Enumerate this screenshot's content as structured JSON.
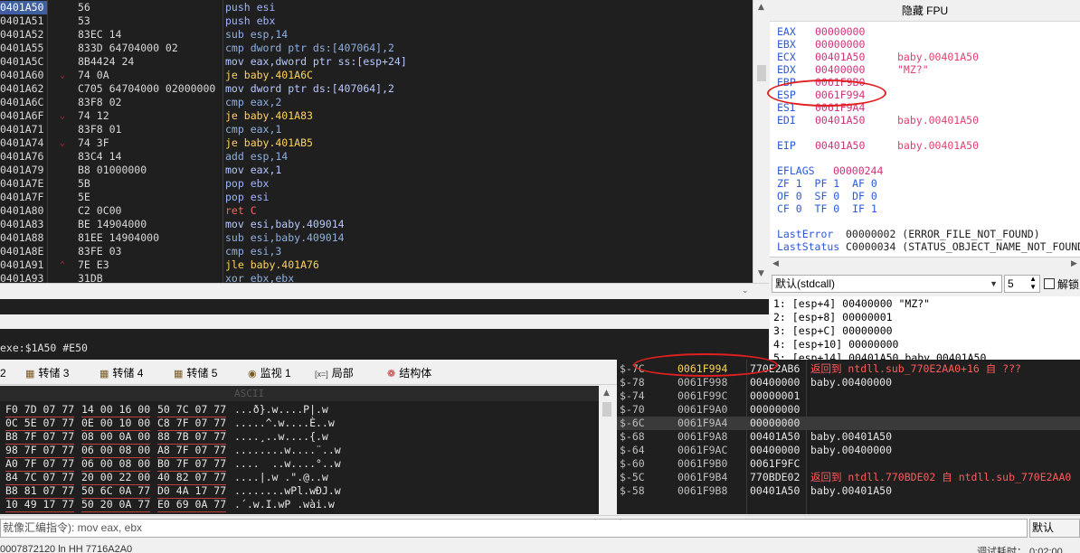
{
  "disassembly": [
    {
      "addr": "0401A50",
      "jmp": "",
      "bytes": "56",
      "ins": "push esi",
      "cls": "c-push",
      "sel": true
    },
    {
      "addr": "0401A51",
      "jmp": "",
      "bytes": "53",
      "ins": "push ebx",
      "cls": "c-push"
    },
    {
      "addr": "0401A52",
      "jmp": "",
      "bytes": "83EC 14",
      "ins": "sub esp,14",
      "cls": "c-arith"
    },
    {
      "addr": "0401A55",
      "jmp": "",
      "bytes": "833D 64704000 02",
      "ins": "cmp dword ptr ds:[407064],2",
      "cls": "c-arith"
    },
    {
      "addr": "0401A5C",
      "jmp": "",
      "bytes": "8B4424 24",
      "ins": "mov eax,dword ptr ss:[esp+24]",
      "cls": "c-mov"
    },
    {
      "addr": "0401A60",
      "jmp": "⌄",
      "bytes": "74 0A",
      "ins": "je baby.401A6C",
      "cls": "c-jmp"
    },
    {
      "addr": "0401A62",
      "jmp": "",
      "bytes": "C705 64704000 02000000",
      "ins": "mov dword ptr ds:[407064],2",
      "cls": "c-mov"
    },
    {
      "addr": "0401A6C",
      "jmp": "",
      "bytes": "83F8 02",
      "ins": "cmp eax,2",
      "cls": "c-arith"
    },
    {
      "addr": "0401A6F",
      "jmp": "⌄",
      "bytes": "74 12",
      "ins": "je baby.401A83",
      "cls": "c-jmp"
    },
    {
      "addr": "0401A71",
      "jmp": "",
      "bytes": "83F8 01",
      "ins": "cmp eax,1",
      "cls": "c-arith"
    },
    {
      "addr": "0401A74",
      "jmp": "⌄",
      "bytes": "74 3F",
      "ins": "je baby.401AB5",
      "cls": "c-jmp"
    },
    {
      "addr": "0401A76",
      "jmp": "",
      "bytes": "83C4 14",
      "ins": "add esp,14",
      "cls": "c-arith"
    },
    {
      "addr": "0401A79",
      "jmp": "",
      "bytes": "B8 01000000",
      "ins": "mov eax,1",
      "cls": "c-mov"
    },
    {
      "addr": "0401A7E",
      "jmp": "",
      "bytes": "5B",
      "ins": "pop ebx",
      "cls": "c-push"
    },
    {
      "addr": "0401A7F",
      "jmp": "",
      "bytes": "5E",
      "ins": "pop esi",
      "cls": "c-push"
    },
    {
      "addr": "0401A80",
      "jmp": "",
      "bytes": "C2 0C00",
      "ins": "ret C",
      "cls": "c-ret"
    },
    {
      "addr": "0401A83",
      "jmp": "",
      "bytes": "BE 14904000",
      "ins": "mov esi,baby.409014",
      "cls": "c-mov"
    },
    {
      "addr": "0401A88",
      "jmp": "",
      "bytes": "81EE 14904000",
      "ins": "sub esi,baby.409014",
      "cls": "c-arith"
    },
    {
      "addr": "0401A8E",
      "jmp": "",
      "bytes": "83FE 03",
      "ins": "cmp esi,3",
      "cls": "c-arith"
    },
    {
      "addr": "0401A91",
      "jmp": "⌃",
      "bytes": "7E E3",
      "ins": "jle baby.401A76",
      "cls": "c-jmp"
    },
    {
      "addr": "0401A93",
      "jmp": "",
      "bytes": "31DB",
      "ins": "xor ebx,ebx",
      "cls": "c-xor"
    }
  ],
  "info_text": "exe:$1A50 #E50",
  "registers_title": "隐藏 FPU",
  "registers": [
    {
      "name": "EAX",
      "value": "00000000",
      "comment": ""
    },
    {
      "name": "EBX",
      "value": "00000000",
      "comment": ""
    },
    {
      "name": "ECX",
      "value": "00401A50",
      "comment": "baby.00401A50"
    },
    {
      "name": "EDX",
      "value": "00400000",
      "comment": "\"MZ?\""
    },
    {
      "name": "EBP",
      "value": "0061F9B0",
      "comment": ""
    },
    {
      "name": "ESP",
      "value": "0061F994",
      "comment": ""
    },
    {
      "name": "ESI",
      "value": "0061F9A4",
      "comment": ""
    },
    {
      "name": "EDI",
      "value": "00401A50",
      "comment": "baby.00401A50"
    },
    {
      "name": "EIP",
      "value": "00401A50",
      "comment": "baby.00401A50"
    }
  ],
  "eflags": {
    "label": "EFLAGS",
    "value": "00000244",
    "row1": "ZF 1  PF 1  AF 0",
    "row2": "OF 0  SF 0  DF 0",
    "row3": "CF 0  TF 0  IF 1"
  },
  "last_error": {
    "label": "LastError",
    "value": "00000002 (ERROR_FILE_NOT_FOUND)"
  },
  "last_status": {
    "label": "LastStatus",
    "value": "C0000034 (STATUS_OBJECT_NAME_NOT_FOUND)"
  },
  "callstack": {
    "convention": "默认(stdcall)",
    "count": "5",
    "unlock_label": "解锁",
    "args": [
      "1: [esp+4] 00400000 \"MZ?\"",
      "2: [esp+8] 00000001",
      "3: [esp+C] 00000000",
      "4: [esp+10] 00000000",
      "5: [esp+14] 00401A50 baby.00401A50"
    ]
  },
  "tabs": [
    {
      "label": "2",
      "icon": ""
    },
    {
      "label": "转储 3",
      "icon": "dump-icon"
    },
    {
      "label": "转储 4",
      "icon": "dump-icon"
    },
    {
      "label": "转储 5",
      "icon": "dump-icon"
    },
    {
      "label": "监视 1",
      "icon": "watch-icon"
    },
    {
      "label": "局部",
      "icon": "locals-icon",
      "glyph": "[x=]"
    },
    {
      "label": "结构体",
      "icon": "struct-icon"
    }
  ],
  "dump_header": "ASCII",
  "dump": [
    {
      "h1": "F0 7D 07 77",
      "h2": "14 00 16 00",
      "h3": "50 7C 07 77",
      "ascii": "...ð}.w....P|.w"
    },
    {
      "h1": "0C 5E 07 77",
      "h2": "0E 00 10 00",
      "h3": "C8 7F 07 77",
      "ascii": ".....^.w....È..w"
    },
    {
      "h1": "B8 7F 07 77",
      "h2": "08 00 0A 00",
      "h3": "88 7B 07 77",
      "ascii": "....¸..w....{.w"
    },
    {
      "h1": "98 7F 07 77",
      "h2": "06 00 08 00",
      "h3": "A8 7F 07 77",
      "ascii": "........w....¨..w"
    },
    {
      "h1": "A0 7F 07 77",
      "h2": "06 00 08 00",
      "h3": "B0 7F 07 77",
      "ascii": "....  ..w....°..w"
    },
    {
      "h1": "84 7C 07 77",
      "h2": "20 00 22 00",
      "h3": "40 82 07 77",
      "ascii": "....|.w .\".@..w"
    },
    {
      "h1": "B8 81 07 77",
      "h2": "50 6C 0A 77",
      "h3": "D0 4A 17 77",
      "ascii": "........wPl.wÐJ.w"
    },
    {
      "h1": "10 49 17 77",
      "h2": "50 20 0A 77",
      "h3": "E0 69 0A 77",
      "ascii": ".´.w.I.wP .wài.w"
    }
  ],
  "stack": [
    {
      "off": "$-7C",
      "addr": "0061F994",
      "val": "770E2AB6",
      "comment": "返回到 ntdll.sub_770E2AA0+16 自 ???",
      "red": true,
      "top": true
    },
    {
      "off": "$-78",
      "addr": "0061F998",
      "val": "00400000",
      "comment": "baby.00400000"
    },
    {
      "off": "$-74",
      "addr": "0061F99C",
      "val": "00000001",
      "comment": ""
    },
    {
      "off": "$-70",
      "addr": "0061F9A0",
      "val": "00000000",
      "comment": ""
    },
    {
      "off": "$-6C",
      "addr": "0061F9A4",
      "val": "00000000",
      "comment": "",
      "hl": true
    },
    {
      "off": "$-68",
      "addr": "0061F9A8",
      "val": "00401A50",
      "comment": "baby.00401A50"
    },
    {
      "off": "$-64",
      "addr": "0061F9AC",
      "val": "00400000",
      "comment": "baby.00400000"
    },
    {
      "off": "$-60",
      "addr": "0061F9B0",
      "val": "0061F9FC",
      "comment": ""
    },
    {
      "off": "$-5C",
      "addr": "0061F9B4",
      "val": "770BDE02",
      "comment": "返回到 ntdll.770BDE02 自 ntdll.sub_770E2AA0",
      "red": true
    },
    {
      "off": "$-58",
      "addr": "0061F9B8",
      "val": "00401A50",
      "comment": "baby.00401A50"
    }
  ],
  "command": {
    "text": "就像汇编指令): mov eax, ebx",
    "mode": "默认"
  },
  "status": {
    "left": "0007872120 ln HH 7716A2A0",
    "right": "调试耗时：  0:02:00"
  }
}
